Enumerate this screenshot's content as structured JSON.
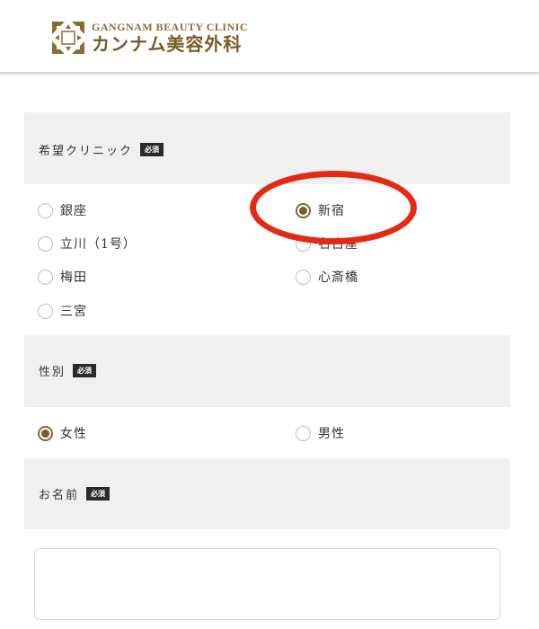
{
  "header": {
    "brand_en": "GANGNAM BEAUTY CLINIC",
    "brand_ja": "カンナム美容外科",
    "brand_color": "#8a6d35"
  },
  "clinic": {
    "label": "希望クリニック",
    "required": "必須",
    "options": [
      "銀座",
      "新宿",
      "立川（1号）",
      "名古屋",
      "梅田",
      "心斎橋",
      "三宮"
    ],
    "selected": "新宿"
  },
  "gender": {
    "label": "性別",
    "required": "必須",
    "options": [
      "女性",
      "男性"
    ],
    "selected": "女性"
  },
  "name": {
    "label": "お名前",
    "required": "必須",
    "value": ""
  },
  "annotation_color": "#e52a14"
}
